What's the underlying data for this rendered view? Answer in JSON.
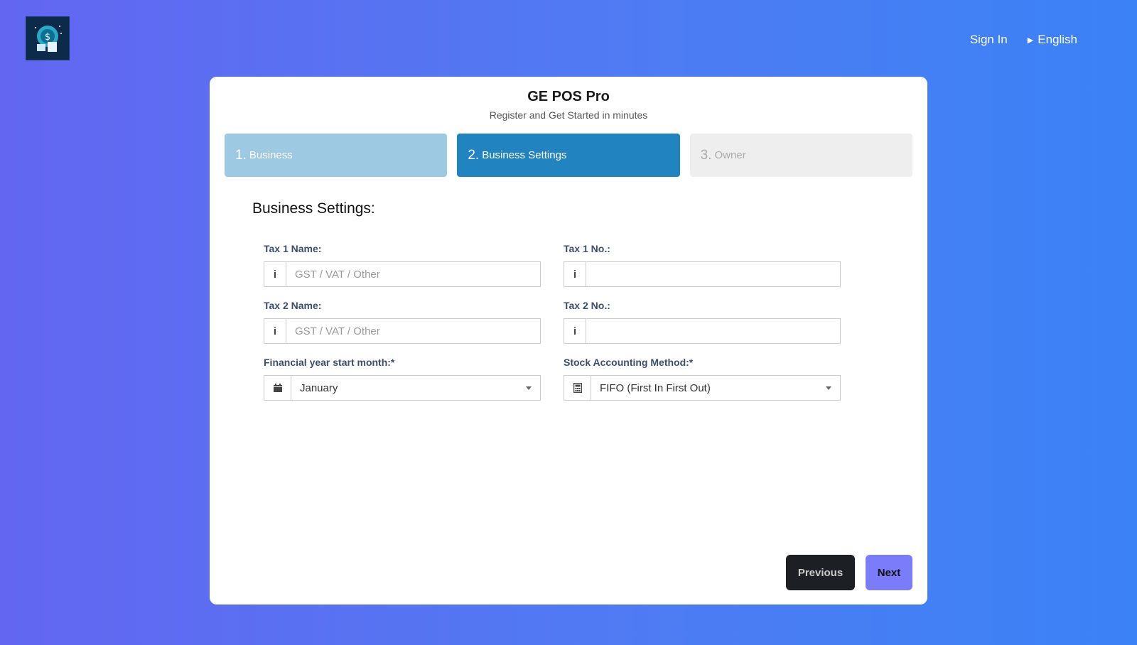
{
  "header": {
    "logo_icon": "money-bag-pos-logo",
    "signin_label": "Sign In",
    "language_label": "English"
  },
  "card": {
    "title": "GE POS Pro",
    "subtitle": "Register and Get Started in minutes"
  },
  "steps": [
    {
      "num": "1.",
      "label": "Business",
      "state": "done"
    },
    {
      "num": "2.",
      "label": "Business Settings",
      "state": "current"
    },
    {
      "num": "3.",
      "label": "Owner",
      "state": "todo"
    }
  ],
  "section_title": "Business Settings:",
  "form": {
    "tax1_name": {
      "label": "Tax 1 Name:",
      "placeholder": "GST / VAT / Other",
      "value": ""
    },
    "tax1_no": {
      "label": "Tax 1 No.:",
      "placeholder": "",
      "value": ""
    },
    "tax2_name": {
      "label": "Tax 2 Name:",
      "placeholder": "GST / VAT / Other",
      "value": ""
    },
    "tax2_no": {
      "label": "Tax 2 No.:",
      "placeholder": "",
      "value": ""
    },
    "fy_month": {
      "label": "Financial year start month:*",
      "value": "January"
    },
    "stock_method": {
      "label": "Stock Accounting Method:*",
      "value": "FIFO (First In First Out)"
    }
  },
  "buttons": {
    "previous": "Previous",
    "next": "Next"
  },
  "colors": {
    "step_done": "#9ec9e2",
    "step_current": "#2184c0",
    "step_todo": "#eeeeee",
    "next_button": "#7b7cfa",
    "previous_button": "#1c1f23"
  }
}
